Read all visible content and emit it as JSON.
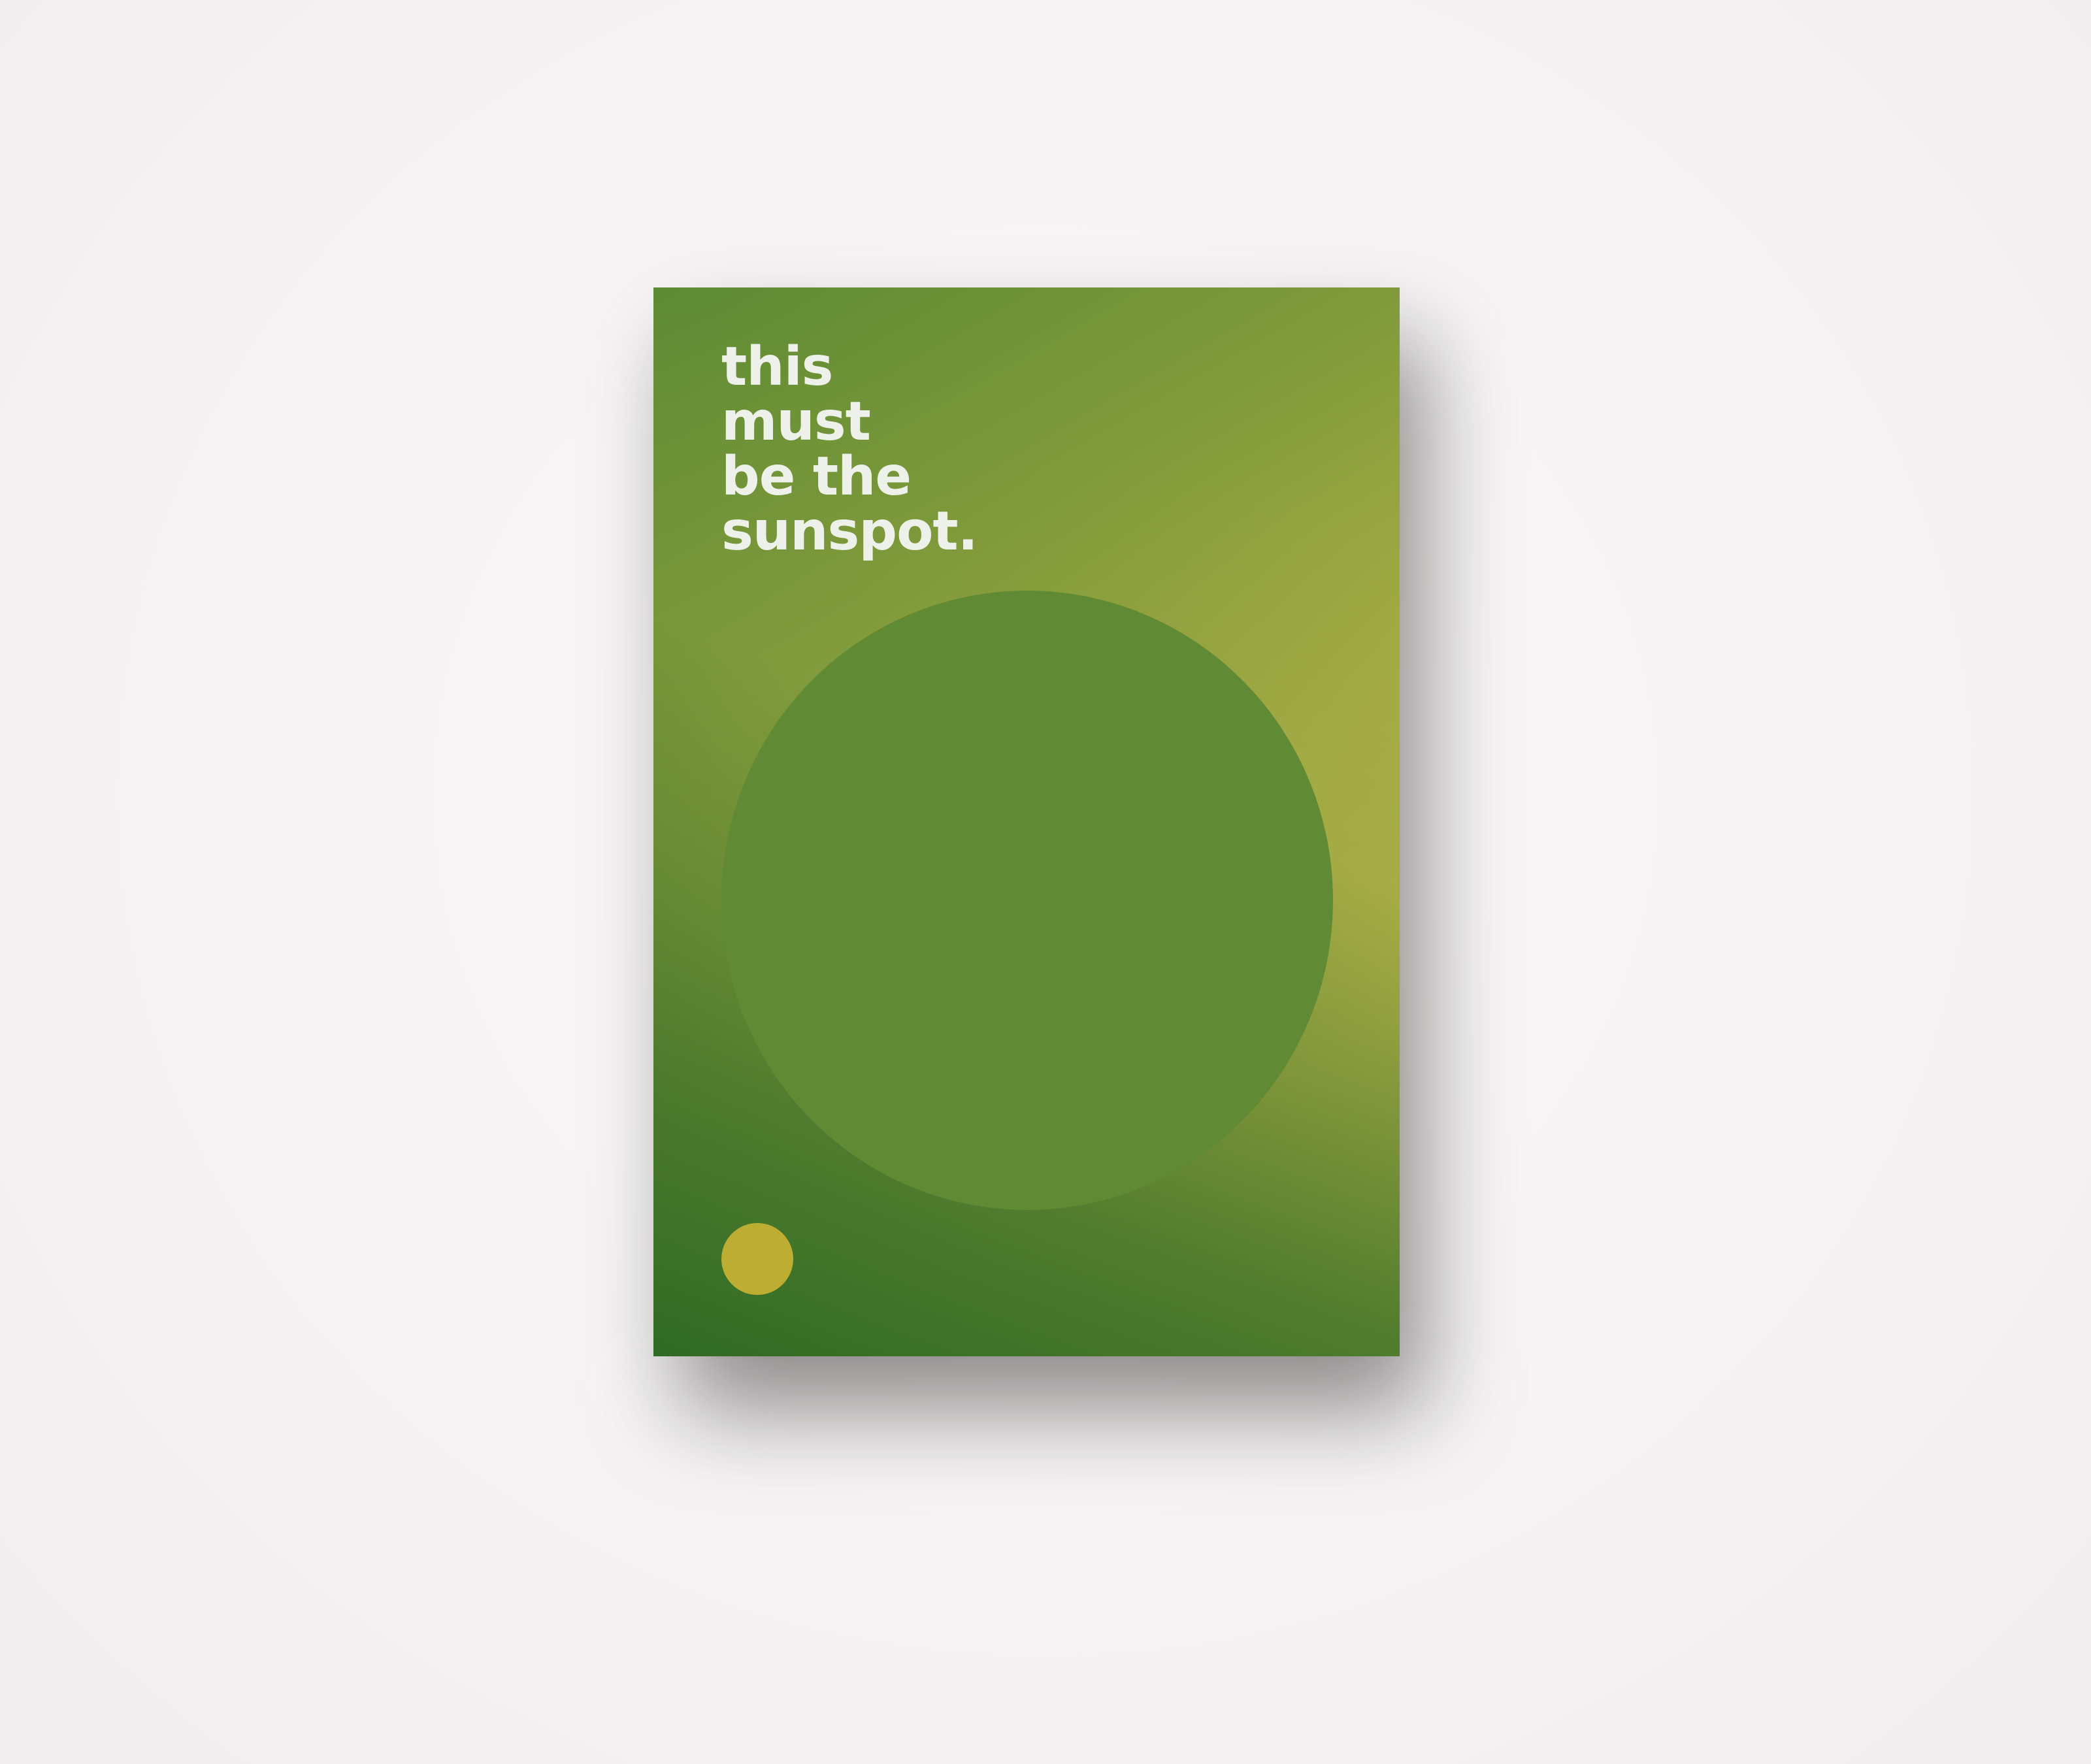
{
  "poster": {
    "headline_lines": [
      "this",
      "must",
      "be the",
      "sunspot."
    ]
  },
  "colors": {
    "background": "#f7f5f5",
    "poster_green_dark": "#2f6a24",
    "poster_yellow": "#c0b74a",
    "sun_disc": "#618a35",
    "dot": "#bdad32",
    "text": "#eef0ea"
  }
}
